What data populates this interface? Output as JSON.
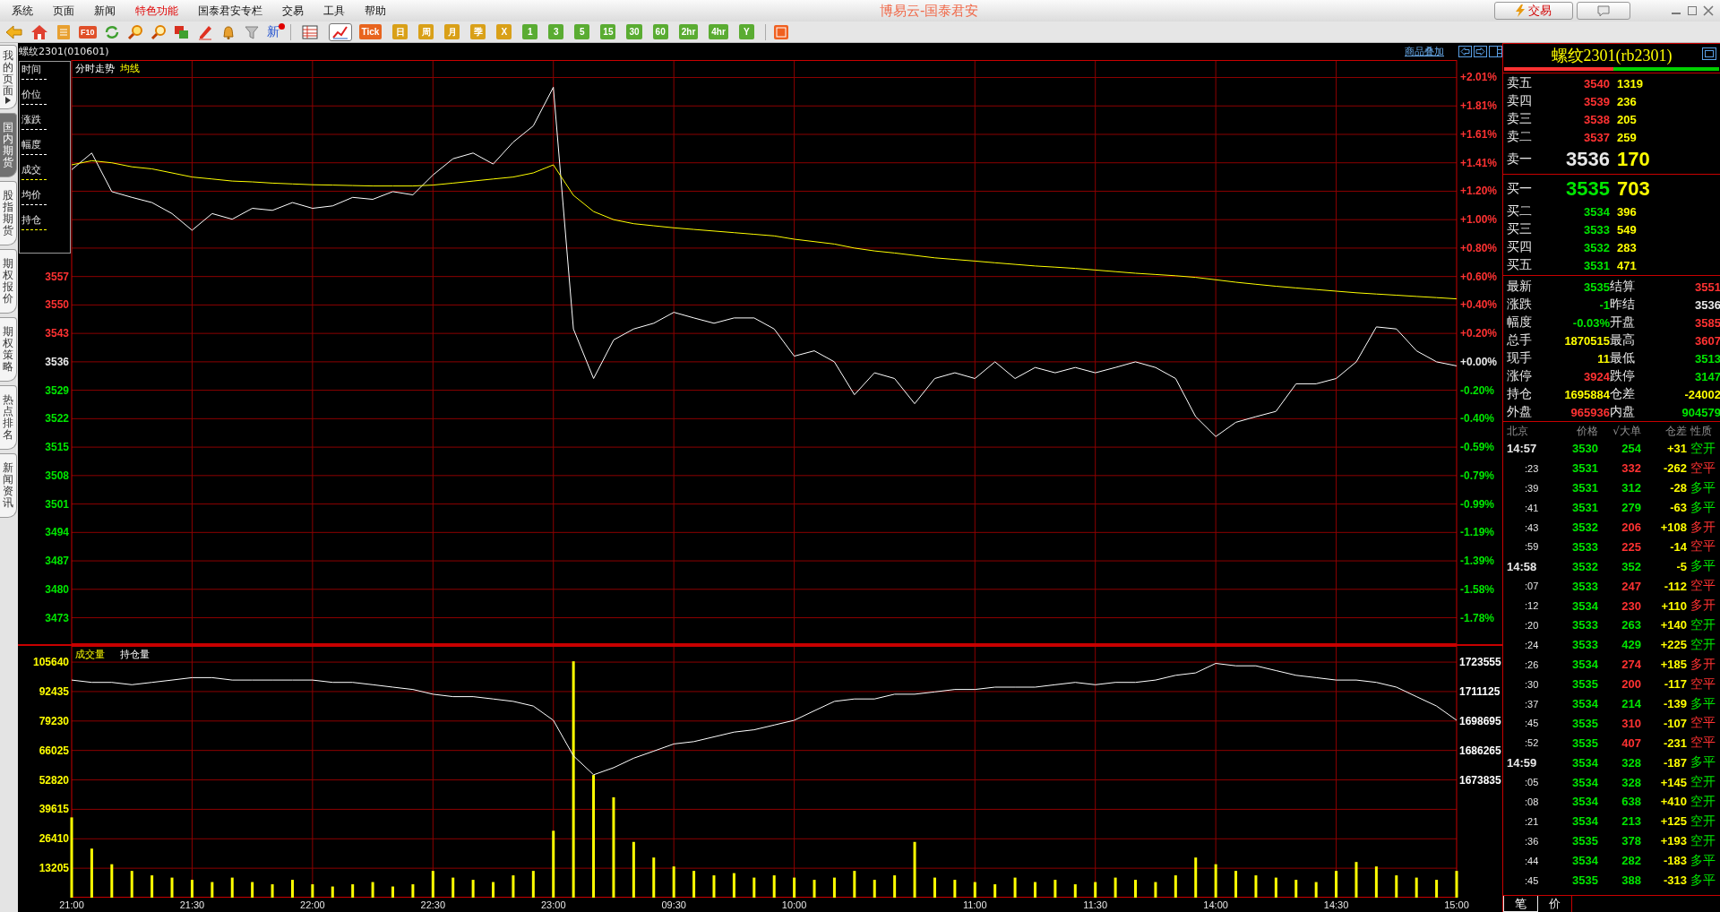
{
  "menu": [
    {
      "label": "系统",
      "selected": false
    },
    {
      "label": "页面",
      "selected": false
    },
    {
      "label": "新闻",
      "selected": false
    },
    {
      "label": "特色功能",
      "selected": true
    },
    {
      "label": "国泰君安专栏",
      "selected": false
    },
    {
      "label": "交易",
      "selected": false
    },
    {
      "label": "工具",
      "selected": false
    },
    {
      "label": "帮助",
      "selected": false
    }
  ],
  "window": {
    "title": "博易云-国泰君安",
    "trade_button": "交易"
  },
  "toolbar": {
    "f10_label": "F10",
    "news_label": "新",
    "views": [
      {
        "selected": false
      },
      {
        "selected": true
      }
    ],
    "periods": [
      {
        "label": "Tick",
        "color": "#e8641e"
      },
      {
        "label": "日",
        "color": "#d9a018"
      },
      {
        "label": "周",
        "color": "#d9a018"
      },
      {
        "label": "月",
        "color": "#d9a018"
      },
      {
        "label": "季",
        "color": "#d9a018"
      },
      {
        "label": "X",
        "color": "#d9a018"
      },
      {
        "label": "1",
        "color": "#5aac32"
      },
      {
        "label": "3",
        "color": "#5aac32"
      },
      {
        "label": "5",
        "color": "#5aac32"
      },
      {
        "label": "15",
        "color": "#5aac32"
      },
      {
        "label": "30",
        "color": "#5aac32"
      },
      {
        "label": "60",
        "color": "#5aac32"
      },
      {
        "label": "2hr",
        "color": "#5aac32"
      },
      {
        "label": "4hr",
        "color": "#5aac32"
      },
      {
        "label": "Y",
        "color": "#5aac32"
      }
    ]
  },
  "side_tabs": [
    {
      "label": "我的页面",
      "selected": false
    },
    {
      "label": "国内期货",
      "selected": true
    },
    {
      "label": "股指期货",
      "selected": false
    },
    {
      "label": "期权报价",
      "selected": false
    },
    {
      "label": "期权策略",
      "selected": false
    },
    {
      "label": "热点排名",
      "selected": false
    },
    {
      "label": "新闻资讯",
      "selected": false
    }
  ],
  "chart_panel": {
    "title": "螺纹2301(010601)",
    "overlay_link": "商品叠加",
    "info_box": [
      {
        "label": "时间",
        "color": "#ffffff"
      },
      {
        "label": "价位",
        "color": "#ffffff"
      },
      {
        "label": "涨跌",
        "color": "#ffffff"
      },
      {
        "label": "幅度",
        "color": "#ffffff"
      },
      {
        "label": "成交",
        "color": "#ffff00"
      },
      {
        "label": "均价",
        "color": "#ffffff"
      },
      {
        "label": "持仓",
        "color": "#ffff00"
      }
    ],
    "main_chart": {
      "percent_axis": [
        {
          "label": "+2.01%",
          "color": "#ff3232"
        },
        {
          "label": "+1.81%",
          "color": "#ff3232"
        },
        {
          "label": "+1.61%",
          "color": "#ff3232"
        },
        {
          "label": "+1.41%",
          "color": "#ff3232"
        },
        {
          "label": "+1.20%",
          "color": "#ff3232"
        },
        {
          "label": "+1.00%",
          "color": "#ff3232"
        },
        {
          "label": "+0.80%",
          "color": "#ff3232"
        },
        {
          "label": "+0.60%",
          "color": "#ff3232"
        },
        {
          "label": "+0.40%",
          "color": "#ff3232"
        },
        {
          "label": "+0.20%",
          "color": "#ff3232"
        },
        {
          "label": "+0.00%",
          "color": "#e8e8e8"
        },
        {
          "label": "-0.20%",
          "color": "#00e600"
        },
        {
          "label": "-0.40%",
          "color": "#00e600"
        },
        {
          "label": "-0.59%",
          "color": "#00e600"
        },
        {
          "label": "-0.79%",
          "color": "#00e600"
        },
        {
          "label": "-0.99%",
          "color": "#00e600"
        },
        {
          "label": "-1.19%",
          "color": "#00e600"
        },
        {
          "label": "-1.39%",
          "color": "#00e600"
        },
        {
          "label": "-1.58%",
          "color": "#00e600"
        },
        {
          "label": "-1.78%",
          "color": "#00e600"
        }
      ],
      "chart_data": {
        "type": "line",
        "grid": true,
        "ylim": [
          3466.5,
          3610.3
        ],
        "yticks": [
          3557,
          3550,
          3543,
          3536,
          3529,
          3522,
          3515,
          3508,
          3501,
          3494,
          3487,
          3480,
          3473
        ],
        "series": [
          {
            "name": "分时走势",
            "color": "#ffffff",
            "values": [
              3583.3,
              3587.4,
              3577.9,
              3576.5,
              3575.2,
              3572.5,
              3568.4,
              3572.5,
              3571.1,
              3573.8,
              3573.3,
              3575.2,
              3573.8,
              3574.4,
              3576.5,
              3576,
              3577.9,
              3577.1,
              3582,
              3586,
              3587.4,
              3584.7,
              3590.1,
              3594.1,
              3603.6,
              3544.1,
              3531.9,
              3541.4,
              3544.1,
              3545.5,
              3548.2,
              3546.8,
              3545.5,
              3546.8,
              3546.8,
              3544.1,
              3537.4,
              3538.7,
              3536,
              3527.9,
              3533.3,
              3531.9,
              3525.7,
              3531.9,
              3533.3,
              3531.9,
              3536,
              3531.9,
              3534.6,
              3533.3,
              3534.6,
              3533.3,
              3534.6,
              3536,
              3534.6,
              3531.9,
              3522.5,
              3517.6,
              3521.1,
              3522.5,
              3523.8,
              3530.6,
              3530.6,
              3531.9,
              3536,
              3544.6,
              3544.1,
              3538.7,
              3536,
              3535
            ]
          },
          {
            "name": "均线",
            "color": "#ffff00",
            "values": [
              3584.5,
              3585.5,
              3585,
              3584,
              3583.5,
              3582.5,
              3581.5,
              3581,
              3580.5,
              3580.3,
              3580,
              3579.8,
              3579.6,
              3579.5,
              3579.4,
              3579.3,
              3579.3,
              3579.3,
              3579.5,
              3580,
              3580.5,
              3581,
              3581.5,
              3582.5,
              3584.5,
              3577,
              3573,
              3571,
              3570,
              3569.5,
              3569,
              3568.6,
              3568.2,
              3567.8,
              3567.4,
              3567,
              3566.2,
              3565.6,
              3565,
              3564,
              3563.3,
              3562.8,
              3562.2,
              3561.6,
              3561.2,
              3560.8,
              3560.4,
              3560,
              3559.6,
              3559.3,
              3559,
              3558.6,
              3558.2,
              3557.8,
              3557.5,
              3557.2,
              3556.8,
              3556.2,
              3555.6,
              3555.1,
              3554.6,
              3554.2,
              3553.8,
              3553.4,
              3553,
              3552.7,
              3552.4,
              3552.1,
              3551.8,
              3551.5
            ]
          }
        ]
      }
    },
    "volume_chart": {
      "chart_data": {
        "type": "bar",
        "grid": true,
        "ylim": [
          0,
          112900
        ],
        "categories": [
          "21:00",
          null,
          null,
          null,
          null,
          null,
          "21:30",
          null,
          null,
          null,
          null,
          null,
          "22:00",
          null,
          null,
          null,
          null,
          null,
          "22:30",
          null,
          null,
          null,
          null,
          null,
          "23:00",
          null,
          null,
          null,
          null,
          null,
          "09:30",
          null,
          null,
          null,
          null,
          null,
          "10:00",
          null,
          null,
          null,
          null,
          null,
          null,
          null,
          null,
          "11:00",
          null,
          null,
          null,
          null,
          null,
          "11:30",
          null,
          null,
          null,
          null,
          null,
          "14:00",
          null,
          null,
          null,
          null,
          null,
          "14:30",
          null,
          null,
          null,
          null,
          null,
          "15:00"
        ],
        "yticks": [
          105640,
          92435,
          79230,
          66025,
          52820,
          39615,
          26410,
          13205
        ],
        "series": [
          {
            "name": "成交量",
            "color": "#ffff00",
            "values": [
              36000,
              22000,
              15000,
              12000,
              10000,
              9000,
              8000,
              7000,
              9000,
              7000,
              6000,
              8000,
              6000,
              5000,
              6000,
              7000,
              5000,
              6000,
              12000,
              9000,
              8000,
              7000,
              10000,
              12000,
              30000,
              106000,
              55000,
              45000,
              25000,
              18000,
              14000,
              12000,
              10000,
              11000,
              9000,
              10000,
              9000,
              8000,
              9000,
              12000,
              8000,
              10000,
              25000,
              9000,
              8000,
              7000,
              6000,
              9000,
              7000,
              8000,
              6000,
              7000,
              9000,
              8000,
              7000,
              10000,
              18000,
              15000,
              12000,
              10000,
              9000,
              8000,
              7000,
              12000,
              16000,
              14000,
              10000,
              9000,
              8000,
              12000
            ]
          }
        ]
      }
    },
    "open_interest_chart": {
      "chart_data": {
        "type": "line",
        "ylim": [
          1624115,
          1730394
        ],
        "yticks": [
          1723555,
          1711125,
          1698695,
          1686265,
          1673835
        ],
        "series": [
          {
            "name": "持仓量",
            "color": "#ffffff",
            "values": [
              1716000,
              1715000,
              1715000,
              1714000,
              1715000,
              1716000,
              1717000,
              1717000,
              1716000,
              1716000,
              1716000,
              1716000,
              1716000,
              1715000,
              1715000,
              1714000,
              1713000,
              1712000,
              1710000,
              1709000,
              1709000,
              1708000,
              1707000,
              1705000,
              1699000,
              1684000,
              1676000,
              1679000,
              1683000,
              1686000,
              1689000,
              1690000,
              1692000,
              1694000,
              1695000,
              1697000,
              1699000,
              1703000,
              1707000,
              1708000,
              1708000,
              1710000,
              1710000,
              1711000,
              1712000,
              1712000,
              1713000,
              1713000,
              1713000,
              1714000,
              1715000,
              1714000,
              1715000,
              1715000,
              1716000,
              1718000,
              1719000,
              1723000,
              1722000,
              1722000,
              1720000,
              1718000,
              1717000,
              1716000,
              1716000,
              1715000,
              1713000,
              1709000,
              1705000,
              1699000
            ]
          }
        ]
      }
    }
  },
  "quote": {
    "title": "螺纹2301(rb2301)",
    "ratio_bar": {
      "level": 0.51
    },
    "asks": [
      {
        "label": "卖五",
        "price": "3540",
        "volume": "1319",
        "kind": "level",
        "color": "#ff3232"
      },
      {
        "label": "卖四",
        "price": "3539",
        "volume": "236",
        "kind": "level",
        "color": "#ff3232"
      },
      {
        "label": "卖三",
        "price": "3538",
        "volume": "205",
        "kind": "level",
        "color": "#ff3232"
      },
      {
        "label": "卖二",
        "price": "3537",
        "volume": "259",
        "kind": "level",
        "color": "#ff3232"
      },
      {
        "label": "卖一",
        "price": "3536",
        "volume": "170",
        "kind": "best",
        "color": "#e8e8e8"
      }
    ],
    "bids": [
      {
        "label": "买一",
        "price": "3535",
        "volume": "703",
        "kind": "best",
        "color": "#00e600"
      },
      {
        "label": "买二",
        "price": "3534",
        "volume": "396",
        "kind": "level",
        "color": "#00e600"
      },
      {
        "label": "买三",
        "price": "3533",
        "volume": "549",
        "kind": "level",
        "color": "#00e600"
      },
      {
        "label": "买四",
        "price": "3532",
        "volume": "283",
        "kind": "level",
        "color": "#00e600"
      },
      {
        "label": "买五",
        "price": "3531",
        "volume": "471",
        "kind": "level",
        "color": "#00e600"
      }
    ],
    "stats": [
      {
        "label": "最新",
        "value": "3535",
        "color": "#00e600"
      },
      {
        "label": "结算",
        "value": "3551",
        "color": "#ff3232"
      },
      {
        "label": "涨跌",
        "value": "-1",
        "color": "#00e600"
      },
      {
        "label": "昨结",
        "value": "3536",
        "color": "#e8e8e8"
      },
      {
        "label": "幅度",
        "value": "-0.03%",
        "color": "#00e600"
      },
      {
        "label": "开盘",
        "value": "3585",
        "color": "#ff3232"
      },
      {
        "label": "总手",
        "value": "1870515",
        "color": "#ffff00"
      },
      {
        "label": "最高",
        "value": "3607",
        "color": "#ff3232"
      },
      {
        "label": "现手",
        "value": "11",
        "color": "#ffff00"
      },
      {
        "label": "最低",
        "value": "3513",
        "color": "#00e600"
      },
      {
        "label": "涨停",
        "value": "3924",
        "color": "#ff3232"
      },
      {
        "label": "跌停",
        "value": "3147",
        "color": "#00e600"
      },
      {
        "label": "持仓",
        "value": "1695884",
        "color": "#ffff00"
      },
      {
        "label": "仓差",
        "value": "-24002",
        "color": "#ffff00"
      },
      {
        "label": "外盘",
        "value": "965936",
        "color": "#ff3232"
      },
      {
        "label": "内盘",
        "value": "904579",
        "color": "#00e600"
      }
    ],
    "tick_columns": [
      "北京",
      "价格",
      "√大单",
      "仓差",
      "性质"
    ],
    "ticks": [
      {
        "time": "14:57",
        "kind": "minute",
        "price": "3530",
        "volume": "254",
        "change": "+31",
        "type": "空开",
        "color": "#00e600"
      },
      {
        "time": ":23",
        "kind": "second",
        "price": "3531",
        "volume": "332",
        "change": "-262",
        "type": "空平",
        "color": "#ff3232"
      },
      {
        "time": ":39",
        "kind": "second",
        "price": "3531",
        "volume": "312",
        "change": "-28",
        "type": "多平",
        "color": "#00e600"
      },
      {
        "time": ":41",
        "kind": "second",
        "price": "3531",
        "volume": "279",
        "change": "-63",
        "type": "多平",
        "color": "#00e600"
      },
      {
        "time": ":43",
        "kind": "second",
        "price": "3532",
        "volume": "206",
        "change": "+108",
        "type": "多开",
        "color": "#ff3232"
      },
      {
        "time": ":59",
        "kind": "second",
        "price": "3533",
        "volume": "225",
        "change": "-14",
        "type": "空平",
        "color": "#ff3232"
      },
      {
        "time": "14:58",
        "kind": "minute",
        "price": "3532",
        "volume": "352",
        "change": "-5",
        "type": "多平",
        "color": "#00e600"
      },
      {
        "time": ":07",
        "kind": "second",
        "price": "3533",
        "volume": "247",
        "change": "-112",
        "type": "空平",
        "color": "#ff3232"
      },
      {
        "time": ":12",
        "kind": "second",
        "price": "3534",
        "volume": "230",
        "change": "+110",
        "type": "多开",
        "color": "#ff3232"
      },
      {
        "time": ":20",
        "kind": "second",
        "price": "3533",
        "volume": "263",
        "change": "+140",
        "type": "空开",
        "color": "#00e600"
      },
      {
        "time": ":24",
        "kind": "second",
        "price": "3533",
        "volume": "429",
        "change": "+225",
        "type": "空开",
        "color": "#00e600"
      },
      {
        "time": ":26",
        "kind": "second",
        "price": "3534",
        "volume": "274",
        "change": "+185",
        "type": "多开",
        "color": "#ff3232"
      },
      {
        "time": ":30",
        "kind": "second",
        "price": "3535",
        "volume": "200",
        "change": "-117",
        "type": "空平",
        "color": "#ff3232"
      },
      {
        "time": ":37",
        "kind": "second",
        "price": "3534",
        "volume": "214",
        "change": "-139",
        "type": "多平",
        "color": "#00e600"
      },
      {
        "time": ":45",
        "kind": "second",
        "price": "3535",
        "volume": "310",
        "change": "-107",
        "type": "空平",
        "color": "#ff3232"
      },
      {
        "time": ":52",
        "kind": "second",
        "price": "3535",
        "volume": "407",
        "change": "-231",
        "type": "空平",
        "color": "#ff3232"
      },
      {
        "time": "14:59",
        "kind": "minute",
        "price": "3534",
        "volume": "328",
        "change": "-187",
        "type": "多平",
        "color": "#00e600"
      },
      {
        "time": ":05",
        "kind": "second",
        "price": "3534",
        "volume": "328",
        "change": "+145",
        "type": "空开",
        "color": "#00e600"
      },
      {
        "time": ":08",
        "kind": "second",
        "price": "3534",
        "volume": "638",
        "change": "+410",
        "type": "空开",
        "color": "#00e600"
      },
      {
        "time": ":21",
        "kind": "second",
        "price": "3534",
        "volume": "213",
        "change": "+125",
        "type": "空开",
        "color": "#00e600"
      },
      {
        "time": ":36",
        "kind": "second",
        "price": "3535",
        "volume": "378",
        "change": "+193",
        "type": "空开",
        "color": "#00e600"
      },
      {
        "time": ":44",
        "kind": "second",
        "price": "3534",
        "volume": "282",
        "change": "-183",
        "type": "多平",
        "color": "#00e600"
      },
      {
        "time": ":45",
        "kind": "second",
        "price": "3535",
        "volume": "388",
        "change": "-313",
        "type": "多平",
        "color": "#00e600"
      }
    ],
    "bottom_tabs": [
      {
        "label": "笔",
        "selected": true
      },
      {
        "label": "价",
        "selected": false
      }
    ]
  }
}
